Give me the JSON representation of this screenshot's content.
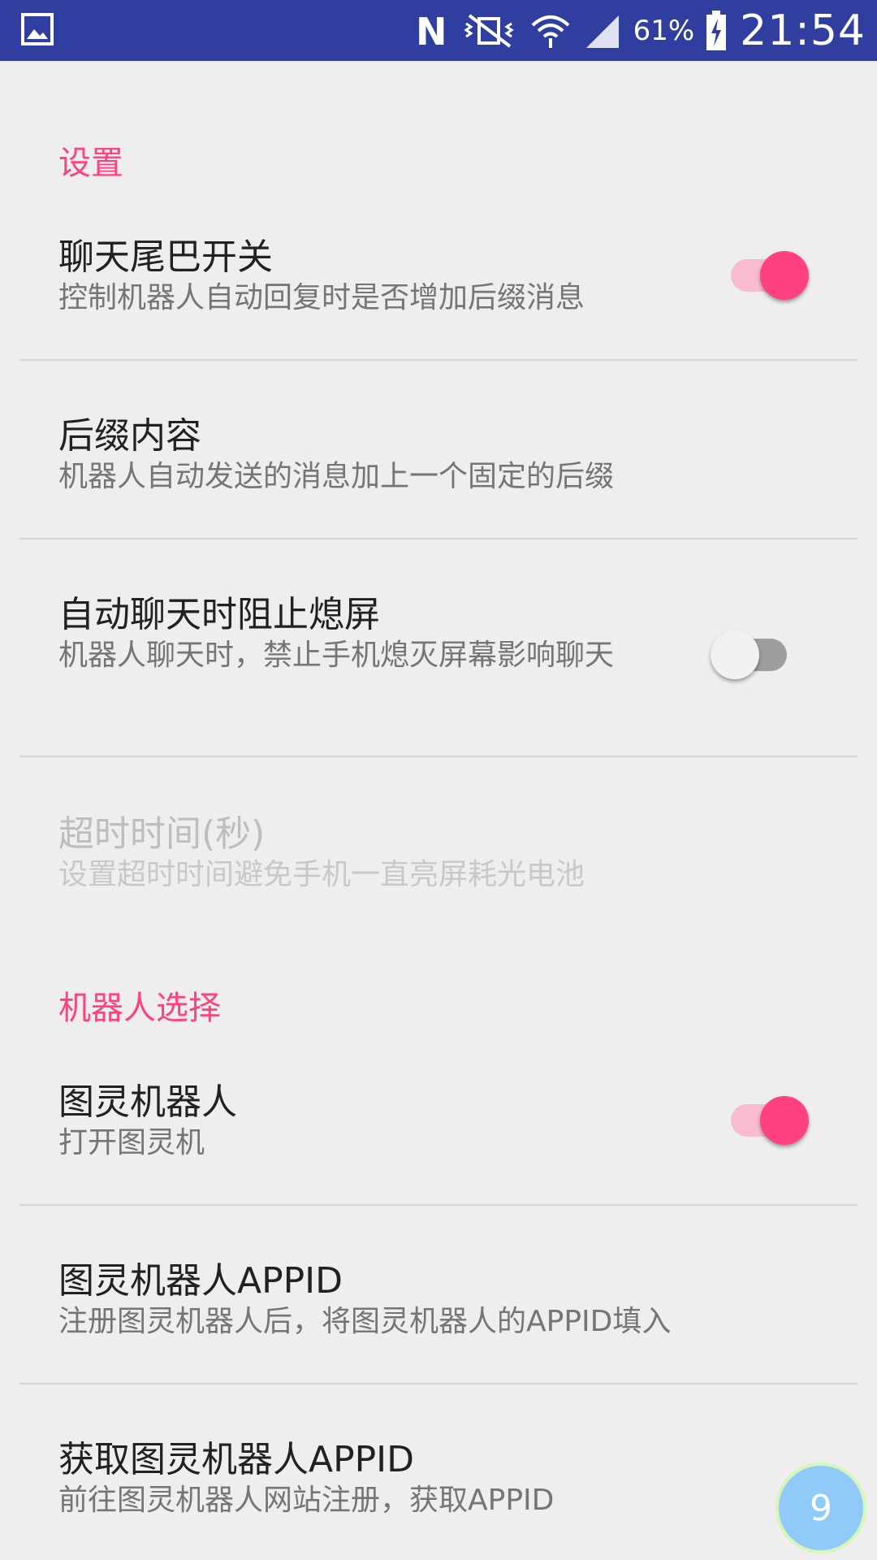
{
  "status_bar": {
    "battery_percent": "61%",
    "time": "21:54",
    "icons": [
      "gallery-icon",
      "nfc-icon",
      "vibrate-mute-icon",
      "wifi-icon",
      "signal-icon",
      "battery-charging-icon"
    ]
  },
  "sections": {
    "settings": {
      "header": "设置",
      "items": [
        {
          "title": "聊天尾巴开关",
          "summary": "控制机器人自动回复时是否增加后缀消息",
          "switch": "on"
        },
        {
          "title": "后缀内容",
          "summary": "机器人自动发送的消息加上一个固定的后缀"
        },
        {
          "title": "自动聊天时阻止熄屏",
          "summary": "机器人聊天时，禁止手机熄灭屏幕影响聊天",
          "switch": "off"
        },
        {
          "title": "超时时间(秒)",
          "summary": "设置超时时间避免手机一直亮屏耗光电池",
          "enabled": false
        }
      ]
    },
    "robot": {
      "header": "机器人选择",
      "items": [
        {
          "title": "图灵机器人",
          "summary": "打开图灵机",
          "switch": "on"
        },
        {
          "title": "图灵机器人APPID",
          "summary": "注册图灵机器人后，将图灵机器人的APPID填入"
        },
        {
          "title": "获取图灵机器人APPID",
          "summary": "前往图灵机器人网站注册，获取APPID"
        }
      ]
    }
  },
  "floating_badge": "9",
  "colors": {
    "status_bar": "#303f9f",
    "accent": "#ff4081",
    "background": "#eeeeee"
  }
}
